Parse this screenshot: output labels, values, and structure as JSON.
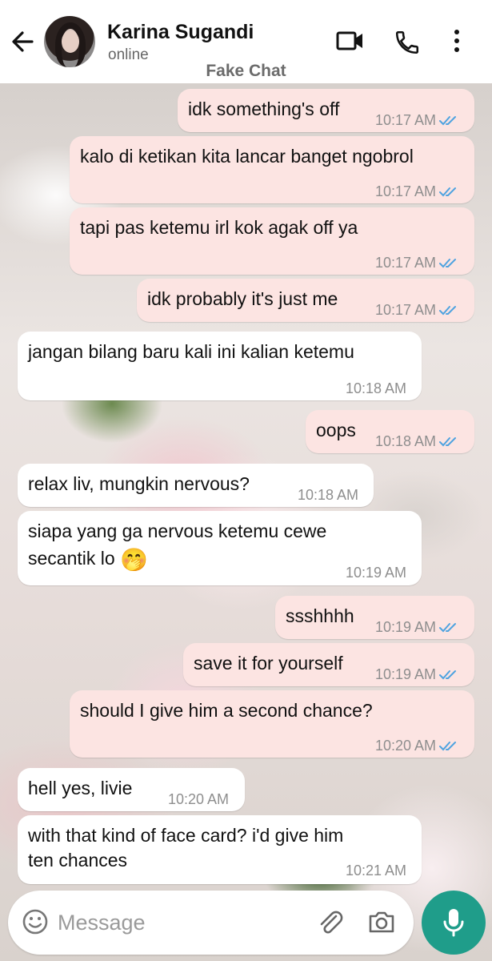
{
  "header": {
    "contact_name": "Karina Sugandi",
    "status": "online",
    "overlay_label": "Fake Chat",
    "icons": [
      "back-arrow-icon",
      "avatar",
      "video-call-icon",
      "phone-icon",
      "more-vert-icon"
    ]
  },
  "messages": [
    {
      "dir": "out",
      "text": "idk something's off",
      "time": "10:17 AM",
      "read": true
    },
    {
      "dir": "out",
      "text": "kalo di ketikan kita lancar banget ngobrol",
      "time": "10:17 AM",
      "read": true
    },
    {
      "dir": "out",
      "text": "tapi pas ketemu irl kok agak off ya",
      "time": "10:17 AM",
      "read": true
    },
    {
      "dir": "out",
      "text": "idk probably it's just me",
      "time": "10:17 AM",
      "read": true
    },
    {
      "dir": "in",
      "text": "jangan bilang baru kali ini kalian ketemu",
      "time": "10:18 AM"
    },
    {
      "dir": "out",
      "text": "oops",
      "time": "10:18 AM",
      "read": true
    },
    {
      "dir": "in",
      "text": "relax liv, mungkin nervous?",
      "time": "10:18 AM"
    },
    {
      "dir": "in",
      "text_line1": "siapa yang ga nervous ketemu cewe",
      "text_line2": "secantik lo",
      "emoji": "🤭",
      "time": "10:19 AM"
    },
    {
      "dir": "out",
      "text": "ssshhhh",
      "time": "10:19 AM",
      "read": true
    },
    {
      "dir": "out",
      "text": "save it for yourself",
      "time": "10:19 AM",
      "read": true
    },
    {
      "dir": "out",
      "text": "should I give him a second chance?",
      "time": "10:20 AM",
      "read": true
    },
    {
      "dir": "in",
      "text": "hell yes, livie",
      "time": "10:20 AM"
    },
    {
      "dir": "in",
      "text_line1": "with that kind of face card? i'd give him",
      "text_line2": "ten chances",
      "time": "10:21 AM"
    }
  ],
  "composer": {
    "placeholder": "Message",
    "icons": [
      "emoji-icon",
      "attach-icon",
      "camera-icon",
      "mic-icon"
    ]
  },
  "colors": {
    "outgoing_bubble": "#fce4e2",
    "incoming_bubble": "#ffffff",
    "read_tick": "#4fa3e0",
    "mic_button": "#1f9d8a"
  }
}
